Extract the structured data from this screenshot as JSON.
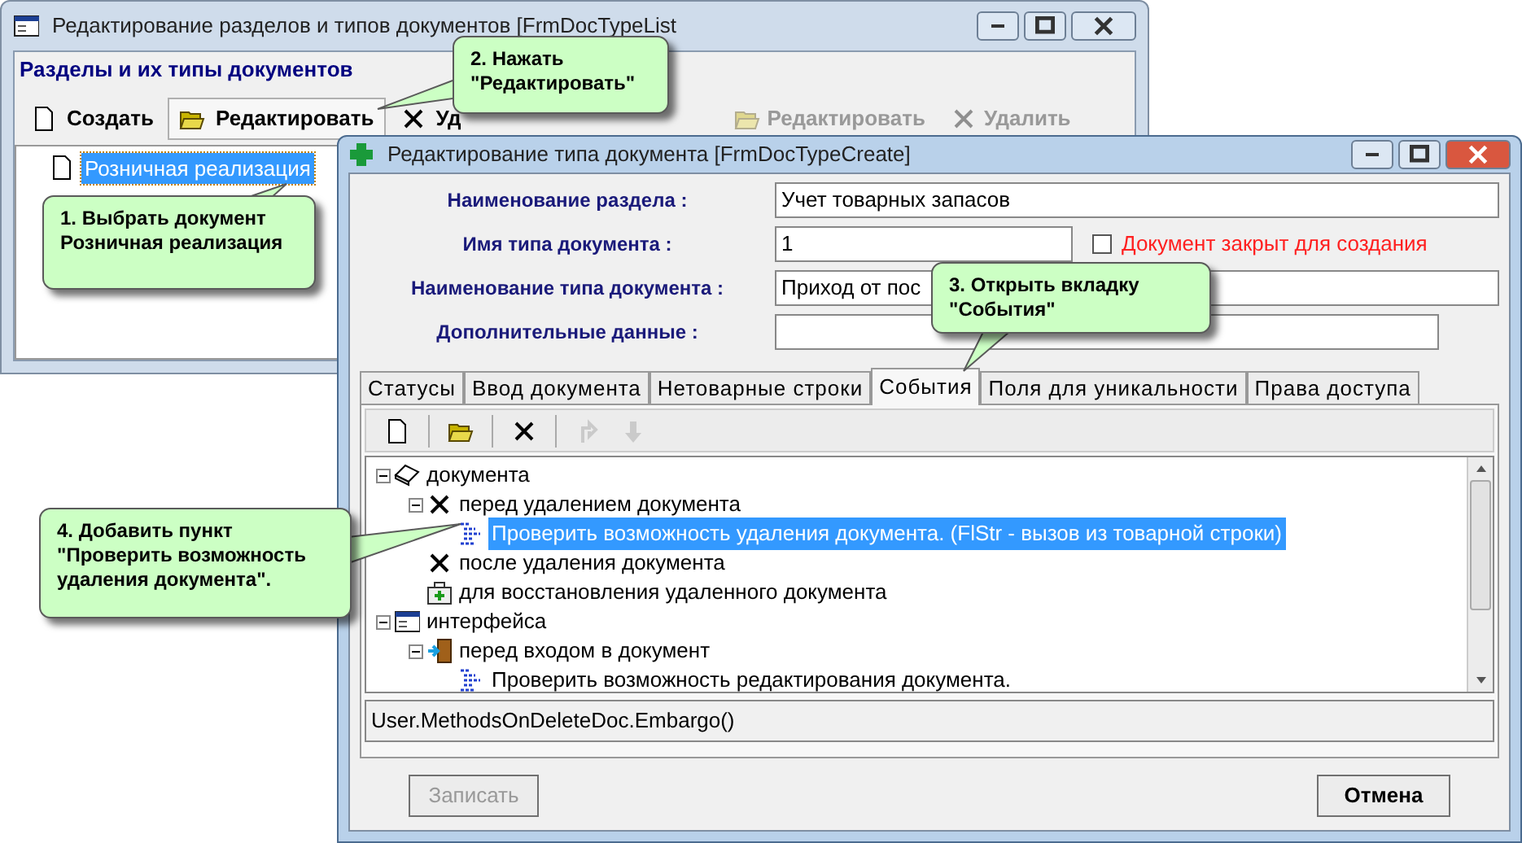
{
  "back_window": {
    "title": "Редактирование разделов и типов документов [FrmDocTypeList",
    "header": "Разделы и их типы документов",
    "toolbar": [
      {
        "label": "Создать",
        "kind": "new",
        "pressed": false
      },
      {
        "label": "Редактировать",
        "kind": "open",
        "pressed": true
      },
      {
        "label": "Уд",
        "kind": "cross",
        "pressed": false
      }
    ],
    "toolbar_2": [
      {
        "label": "Редактировать",
        "kind": "open",
        "disabled": true
      },
      {
        "label": "Удалить",
        "kind": "cross",
        "disabled": true
      }
    ],
    "tree": [
      {
        "label": "Розничная реализация",
        "selected": true
      }
    ]
  },
  "front_window": {
    "title": "Редактирование типа документа [FrmDocTypeCreate]",
    "fields": [
      {
        "label": "Наименование раздела :",
        "value": "Учет товарных запасов",
        "kind": "wide"
      },
      {
        "label": "Имя типа документа :",
        "value": "1",
        "kind": "short"
      },
      {
        "label": "Наименование типа документа :",
        "value": "Приход от пос",
        "kind": "wide"
      },
      {
        "label": "Дополнительные данные :",
        "kind": "medium"
      }
    ],
    "closed_checkbox": {
      "label": "Документ закрыт для создания",
      "checked": false
    },
    "tabs": [
      {
        "label": "Статусы",
        "selected": false
      },
      {
        "label": "Ввод документа",
        "selected": false
      },
      {
        "label": "Нетоварные строки",
        "selected": false
      },
      {
        "label": "События",
        "selected": true
      },
      {
        "label": "Поля для уникальности",
        "selected": false
      },
      {
        "label": "Права доступа",
        "selected": false
      }
    ],
    "toolbar": [
      {
        "kind": "new",
        "disabled": false
      },
      {
        "kind": "open",
        "disabled": false
      },
      {
        "kind": "cross",
        "disabled": false
      },
      {
        "kind": "up",
        "disabled": true
      },
      {
        "kind": "down",
        "disabled": true
      }
    ],
    "tree": [
      {
        "label": "документа",
        "kind": "book",
        "expanded": true,
        "selected": false,
        "children": [
          {
            "label": "перед удалением документа",
            "kind": "cross",
            "expanded": true,
            "selected": false,
            "children": [
              {
                "label": "Проверить возможность удаления документа. (FlStr - вызов из товарной строки)",
                "kind": "method",
                "selected": true
              }
            ]
          },
          {
            "label": "после удаления документа",
            "kind": "cross",
            "selected": false
          },
          {
            "label": "для восстановления удаленного документа",
            "kind": "medkit",
            "selected": false
          }
        ]
      },
      {
        "label": "интерфейса",
        "kind": "window",
        "expanded": true,
        "selected": false,
        "children": [
          {
            "label": "перед входом в документ",
            "kind": "door",
            "expanded": true,
            "selected": false,
            "children": [
              {
                "label": "Проверить возможность редактирования документа.",
                "kind": "method",
                "selected": false
              }
            ]
          }
        ]
      }
    ],
    "code": "User.MethodsOnDeleteDoc.Embargo()",
    "buttons": [
      {
        "label": "Записать",
        "disabled": true
      },
      {
        "label": "Отмена",
        "disabled": false
      }
    ]
  },
  "callouts": [
    "1. Выбрать документ\nРозничная реализация",
    "2. Нажать\n\"Редактировать\"",
    "3. Открыть вкладку\n\"События\"",
    "4. Добавить пункт\n\"Проверить возможность\nудаления документа\"."
  ]
}
